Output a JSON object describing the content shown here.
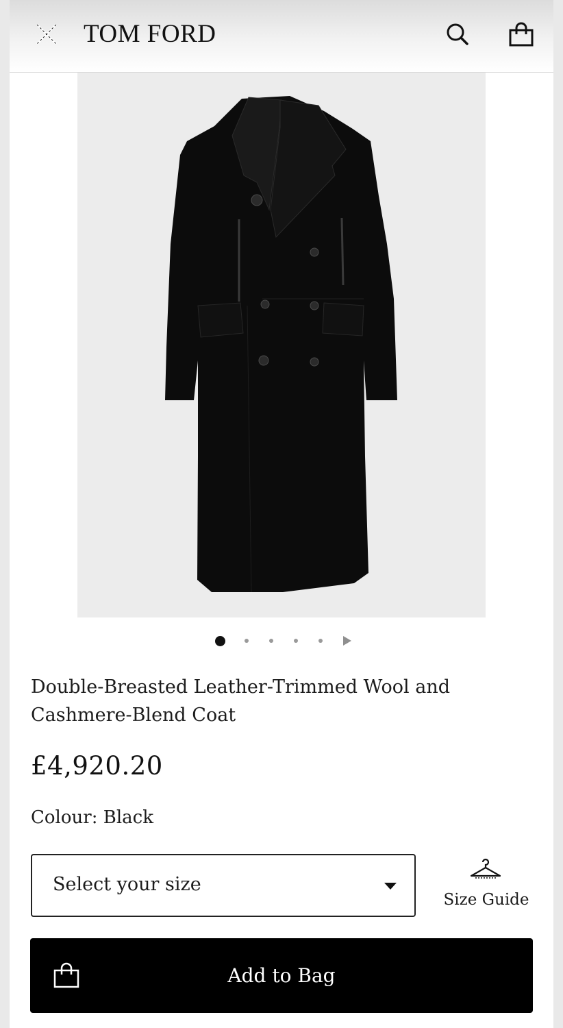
{
  "header": {
    "brand": "TOM FORD",
    "menu_icon": "close-icon",
    "search_icon": "search-icon",
    "bag_icon": "shopping-bag-icon"
  },
  "product": {
    "image_alt": "black double-breasted coat",
    "title": "Double-Breasted Leather-Trimmed Wool and Cashmere-Blend Coat",
    "price": "£4,920.20",
    "colour": "Colour: Black"
  },
  "carousel": {
    "total_images": 6,
    "active_index": 1
  },
  "size_select": {
    "placeholder": "Select your size"
  },
  "size_guide": {
    "label": "Size Guide",
    "icon": "hanger-icon"
  },
  "add_to_bag": {
    "label": "Add to Bag",
    "icon": "shopping-bag-icon"
  },
  "colors": {
    "button_bg": "#000000",
    "image_bg": "#ececec"
  }
}
